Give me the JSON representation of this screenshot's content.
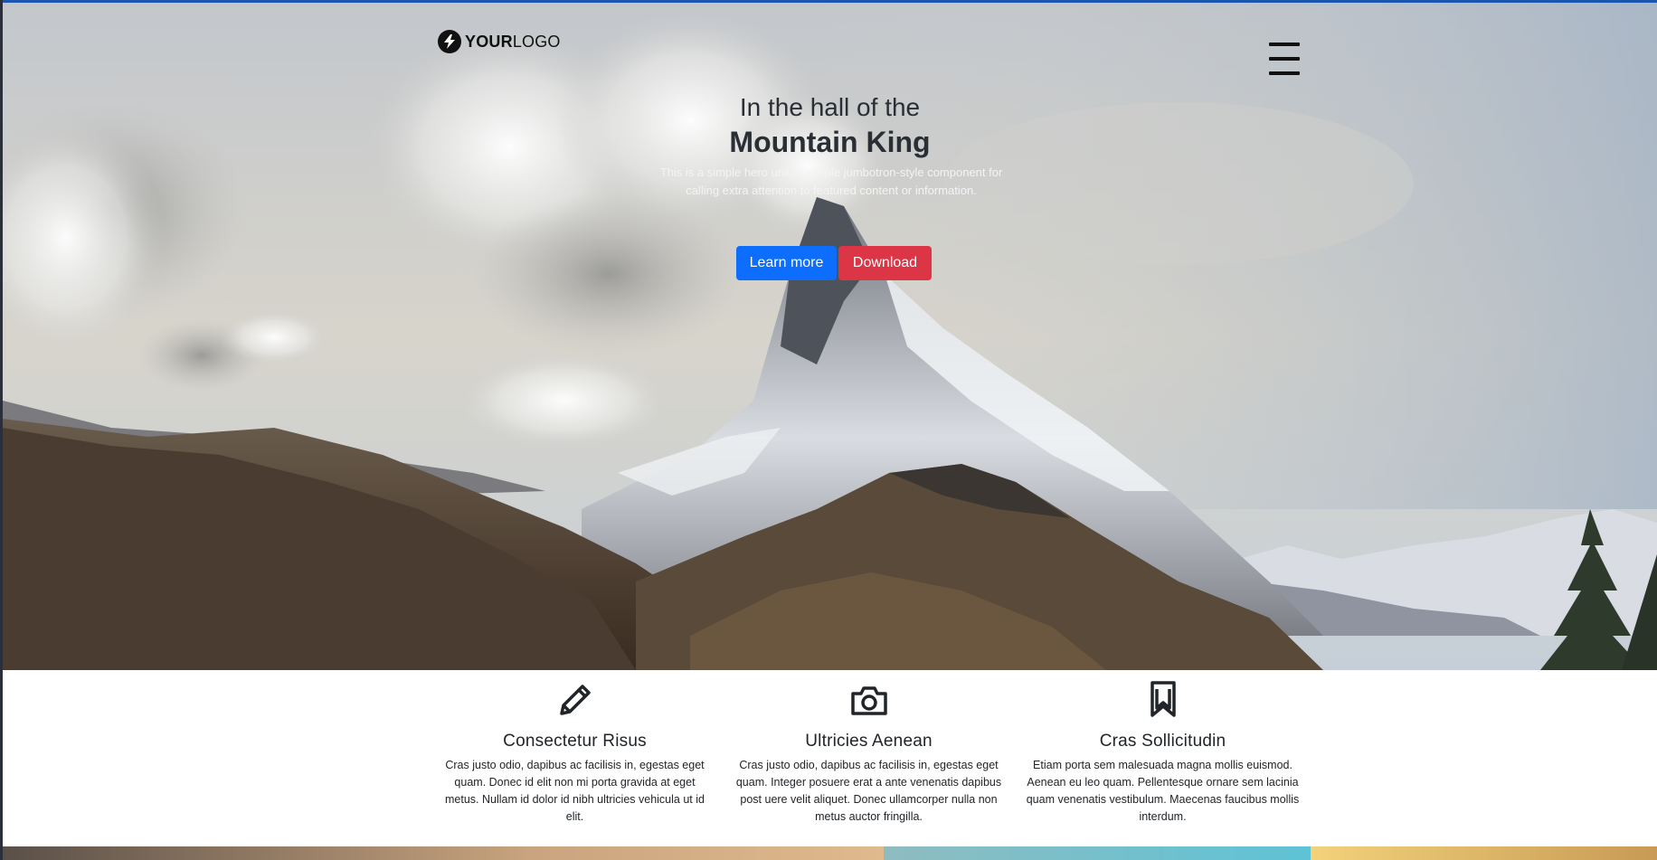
{
  "header": {
    "logo": {
      "bold": "YOUR",
      "light": "LOGO"
    },
    "menu_icon": "hamburger-menu-icon"
  },
  "hero": {
    "title_line1": "In the hall of the",
    "title_line2": "Mountain King",
    "lead": "This is a simple hero unit, a simple jumbotron-style component for calling extra attention to featured content or information.",
    "buttons": [
      {
        "label": "Learn more",
        "color": "#0d6efd"
      },
      {
        "label": "Download",
        "color": "#dc3545"
      }
    ]
  },
  "features": [
    {
      "icon": "pencil-icon",
      "title": "Consectetur Risus",
      "text": "Cras justo odio, dapibus ac facilisis in, egestas eget quam. Donec id elit non mi porta gravida at eget metus. Nullam id dolor id nibh ultricies vehicula ut id elit."
    },
    {
      "icon": "camera-icon",
      "title": "Ultricies Aenean",
      "text": "Cras justo odio, dapibus ac facilisis in, egestas eget quam. Integer posuere erat a ante venenatis dapibus post uere velit aliquet. Donec ullamcorper nulla non metus auctor fringilla."
    },
    {
      "icon": "bookmark-icon",
      "title": "Cras Sollicitudin",
      "text": "Etiam porta sem malesuada magna mollis euismod. Aenean eu leo quam. Pellentesque ornare sem lacinia quam venenatis vestibulum. Maecenas faucibus mollis interdum."
    }
  ]
}
